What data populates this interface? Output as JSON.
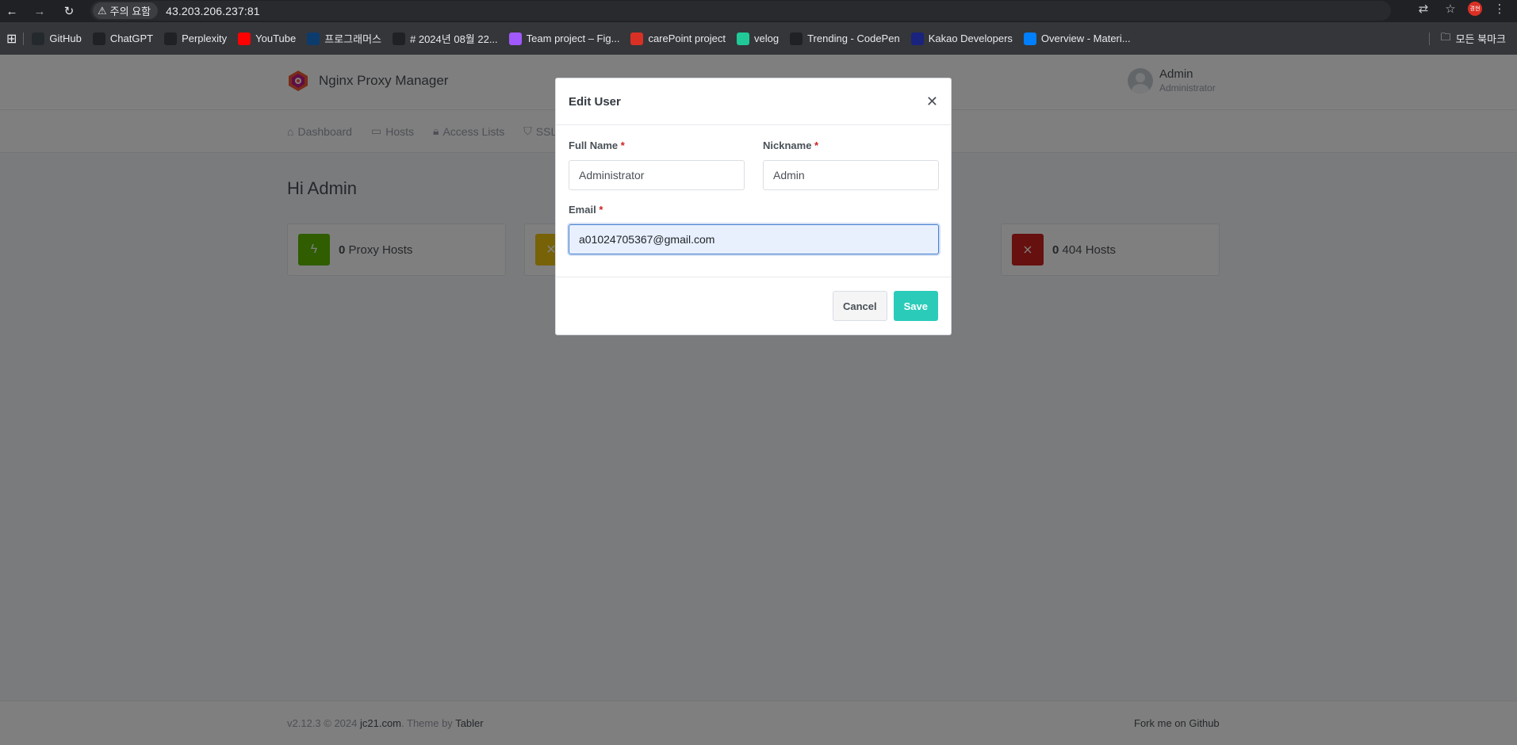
{
  "browser": {
    "security_label": "주의 요함",
    "url": "43.203.206.237:81",
    "profile_initials": "경현",
    "bookmarks": [
      {
        "label": "GitHub",
        "icon": "github-icon",
        "color": "#24292e"
      },
      {
        "label": "ChatGPT",
        "icon": "chatgpt-icon",
        "color": "#202124"
      },
      {
        "label": "Perplexity",
        "icon": "perplexity-icon",
        "color": "#202124"
      },
      {
        "label": "YouTube",
        "icon": "youtube-icon",
        "color": "#ff0000"
      },
      {
        "label": "프로그래머스",
        "icon": "programmers-icon",
        "color": "#0c3c6e"
      },
      {
        "label": "# 2024년 08월 22...",
        "icon": "notion-triangle-icon",
        "color": "#202124"
      },
      {
        "label": "Team project – Fig...",
        "icon": "figma-icon",
        "color": "#a259ff"
      },
      {
        "label": "carePoint project",
        "icon": "carepoint-icon",
        "color": "#d93025"
      },
      {
        "label": "velog",
        "icon": "velog-icon",
        "color": "#20c997"
      },
      {
        "label": "Trending - CodePen",
        "icon": "codepen-icon",
        "color": "#202124"
      },
      {
        "label": "Kakao Developers",
        "icon": "kakao-icon",
        "color": "#1a237e"
      },
      {
        "label": "Overview - Materi...",
        "icon": "mui-icon",
        "color": "#007fff"
      }
    ],
    "all_bookmarks_label": "모든 북마크"
  },
  "app": {
    "brand": "Nginx Proxy Manager",
    "user": {
      "name": "Admin",
      "role": "Administrator"
    },
    "nav": [
      {
        "label": "Dashboard",
        "icon": "home-icon"
      },
      {
        "label": "Hosts",
        "icon": "monitor-icon"
      },
      {
        "label": "Access Lists",
        "icon": "lock-icon"
      },
      {
        "label": "SSL",
        "icon": "shield-icon"
      }
    ],
    "greeting": "Hi Admin",
    "stats": [
      {
        "count": "0",
        "label": "Proxy Hosts",
        "color": "#5eba00",
        "icon": "zap-icon"
      },
      {
        "count": "",
        "label": "",
        "color": "#f1c40f",
        "icon": "shuffle-icon"
      },
      {
        "count": "0",
        "label": "404 Hosts",
        "color": "#cd201f",
        "icon": "zap-off-icon"
      }
    ],
    "footer": {
      "version": "v2.12.3 © 2024 ",
      "author_link": "jc21.com",
      "theme_text": ". Theme by ",
      "theme_link": "Tabler",
      "fork": "Fork me on Github"
    }
  },
  "modal": {
    "title": "Edit User",
    "full_name_label": "Full Name",
    "full_name_value": "Administrator",
    "nickname_label": "Nickname",
    "nickname_value": "Admin",
    "email_label": "Email",
    "email_value": "a01024705367@gmail.com",
    "required_mark": "*",
    "cancel_label": "Cancel",
    "save_label": "Save"
  }
}
